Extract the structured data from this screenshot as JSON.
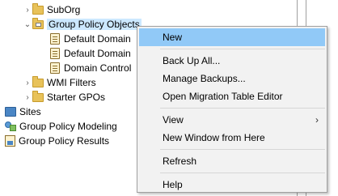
{
  "tree": {
    "suborg": "SubOrg",
    "gpo_folder": "Group Policy Objects",
    "gpo_item_1": "Default Domain",
    "gpo_item_2": "Default Domain",
    "gpo_item_3": "Domain Control",
    "wmi_filters": "WMI Filters",
    "starter_gpos": "Starter GPOs",
    "sites": "Sites",
    "gp_modeling": "Group Policy Modeling",
    "gp_results": "Group Policy Results"
  },
  "context_menu": {
    "new": "New",
    "back_up_all": "Back Up All...",
    "manage_backups": "Manage Backups...",
    "open_migration_table_editor": "Open Migration Table Editor",
    "view": "View",
    "view_arrow": "›",
    "new_window_from_here": "New Window from Here",
    "refresh": "Refresh",
    "help": "Help"
  },
  "icons": {
    "expand": "›",
    "collapse": "⌄"
  },
  "colors": {
    "menu_highlight": "#91c9f7",
    "selected_item": "#cce8ff",
    "menu_background": "#f2f2f2"
  }
}
